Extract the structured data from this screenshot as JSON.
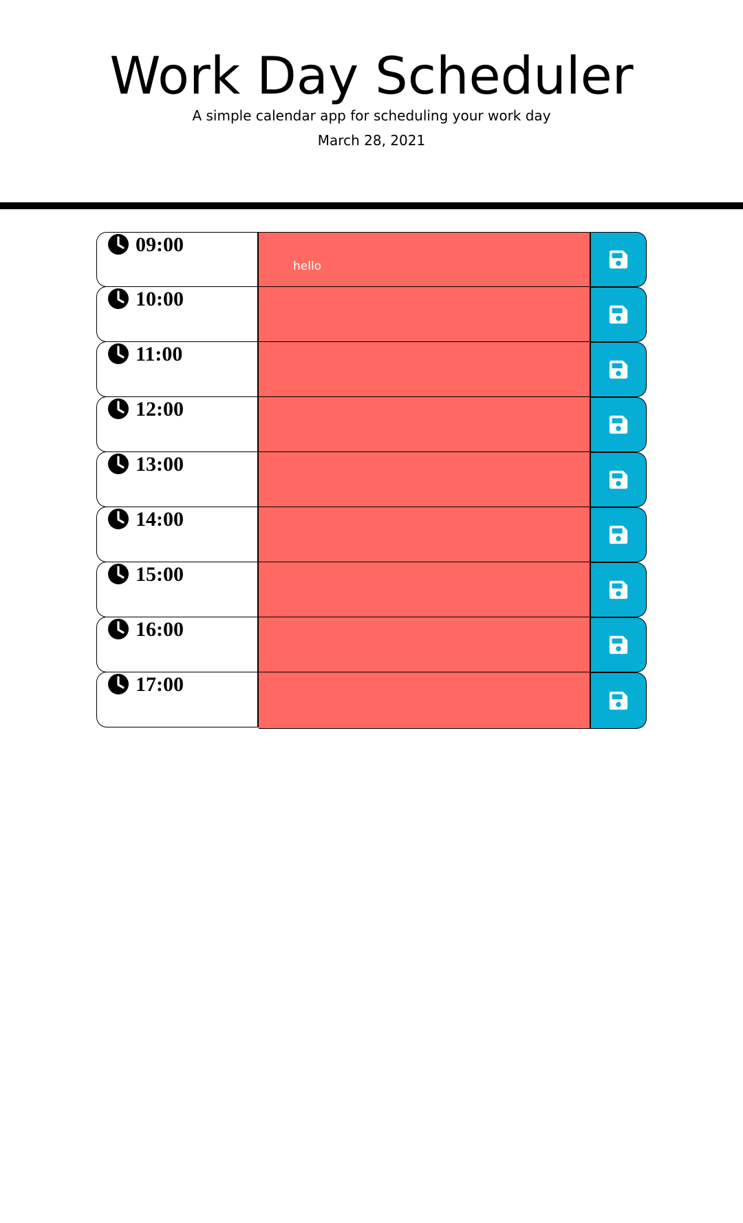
{
  "header": {
    "title": "Work Day Scheduler",
    "subtitle": "A simple calendar app for scheduling your work day",
    "date": "March 28, 2021"
  },
  "colors": {
    "past": "#ff6961",
    "save_button": "#06aed5",
    "divider": "#000000"
  },
  "icons": {
    "hour": "clock-icon",
    "save": "floppy-disk-icon"
  },
  "timeblocks": [
    {
      "hour": "09:00",
      "text": "hello"
    },
    {
      "hour": "10:00",
      "text": ""
    },
    {
      "hour": "11:00",
      "text": ""
    },
    {
      "hour": "12:00",
      "text": ""
    },
    {
      "hour": "13:00",
      "text": ""
    },
    {
      "hour": "14:00",
      "text": ""
    },
    {
      "hour": "15:00",
      "text": ""
    },
    {
      "hour": "16:00",
      "text": ""
    },
    {
      "hour": "17:00",
      "text": ""
    }
  ]
}
